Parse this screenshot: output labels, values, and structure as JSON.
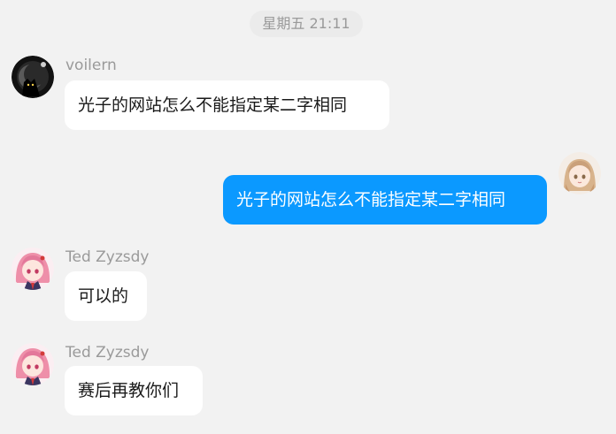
{
  "chat": {
    "timestamp": "星期五 21:11",
    "messages": [
      {
        "direction": "incoming",
        "sender": "voilern",
        "avatar_icon": "dark-cat-avatar-icon",
        "text": "光子的网站怎么不能指定某二字相同"
      },
      {
        "direction": "outgoing",
        "sender": "",
        "avatar_icon": "anime-girl-avatar-icon",
        "text": "光子的网站怎么不能指定某二字相同"
      },
      {
        "direction": "incoming",
        "sender": "Ted Zyzsdy",
        "avatar_icon": "pink-hair-avatar-icon",
        "text": "可以的"
      },
      {
        "direction": "incoming",
        "sender": "Ted Zyzsdy",
        "avatar_icon": "pink-hair-avatar-icon",
        "text": "赛后再教你们"
      }
    ]
  },
  "colors": {
    "background": "#f2f2f2",
    "incoming_bubble": "#ffffff",
    "outgoing_bubble": "#0b99ff",
    "name_text": "#9a9a9a"
  }
}
